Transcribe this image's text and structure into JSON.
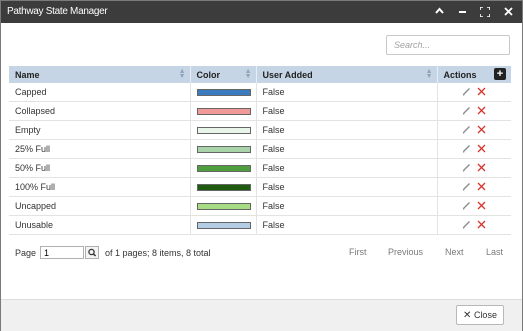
{
  "window": {
    "title": "Pathway State Manager"
  },
  "search": {
    "placeholder": "Search..."
  },
  "table": {
    "headers": {
      "name": "Name",
      "color": "Color",
      "user_added": "User Added",
      "actions": "Actions"
    },
    "rows": [
      {
        "name": "Capped",
        "color": "#3a7bbf",
        "user_added": "False"
      },
      {
        "name": "Collapsed",
        "color": "#f09a9a",
        "user_added": "False"
      },
      {
        "name": "Empty",
        "color": "#eaf5ea",
        "user_added": "False"
      },
      {
        "name": "25% Full",
        "color": "#a9d4a9",
        "user_added": "False"
      },
      {
        "name": "50% Full",
        "color": "#4e9e3e",
        "user_added": "False"
      },
      {
        "name": "100% Full",
        "color": "#1e5a10",
        "user_added": "False"
      },
      {
        "name": "Uncapped",
        "color": "#a8dc84",
        "user_added": "False"
      },
      {
        "name": "Unusable",
        "color": "#b4cde4",
        "user_added": "False"
      }
    ]
  },
  "pager": {
    "page_label": "Page",
    "page_value": "1",
    "summary": "of 1 pages; 8 items, 8 total",
    "first": "First",
    "previous": "Previous",
    "next": "Next",
    "last": "Last"
  },
  "footer": {
    "close_label": "Close"
  },
  "colors": {
    "titlebar": "#3c3c3c",
    "header": "#c5d5e5",
    "delete": "#d9342b"
  }
}
